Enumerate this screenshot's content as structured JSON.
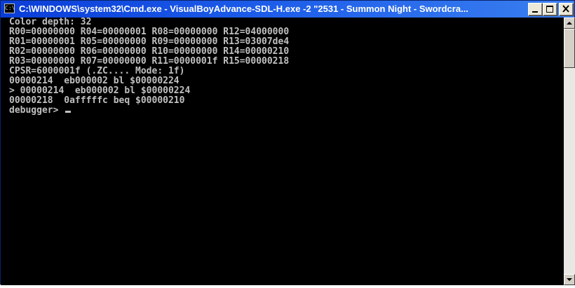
{
  "window": {
    "title": "C:\\WINDOWS\\system32\\Cmd.exe - VisualBoyAdvance-SDL-H.exe -2 \"2531 - Summon Night - Swordcra...",
    "icon_glyph": "C:\\",
    "controls": {
      "minimize_icon": "minimize-icon",
      "maximize_icon": "maximize-icon",
      "close_icon": "close-icon"
    }
  },
  "console": {
    "lines": [
      "Color depth: 32",
      "R00=00000000 R04=00000001 R08=00000000 R12=04000000",
      "R01=00000001 R05=00000000 R09=00000000 R13=03007de4",
      "R02=00000000 R06=00000000 R10=00000000 R14=00000210",
      "R03=00000000 R07=00000000 R11=0000001f R15=00000218",
      "CPSR=6000001f (.ZC.... Mode: 1f)",
      "00000214  eb000002 bl $00000224",
      "> 00000214  eb000002 bl $00000224",
      "00000218  0afffffc beq $00000210"
    ],
    "prompt": "debugger> ",
    "text_color": "#c0c0c0",
    "background_color": "#000000"
  },
  "scrollbar": {
    "up_icon": "scroll-up-arrow-icon",
    "down_icon": "scroll-down-arrow-icon"
  }
}
